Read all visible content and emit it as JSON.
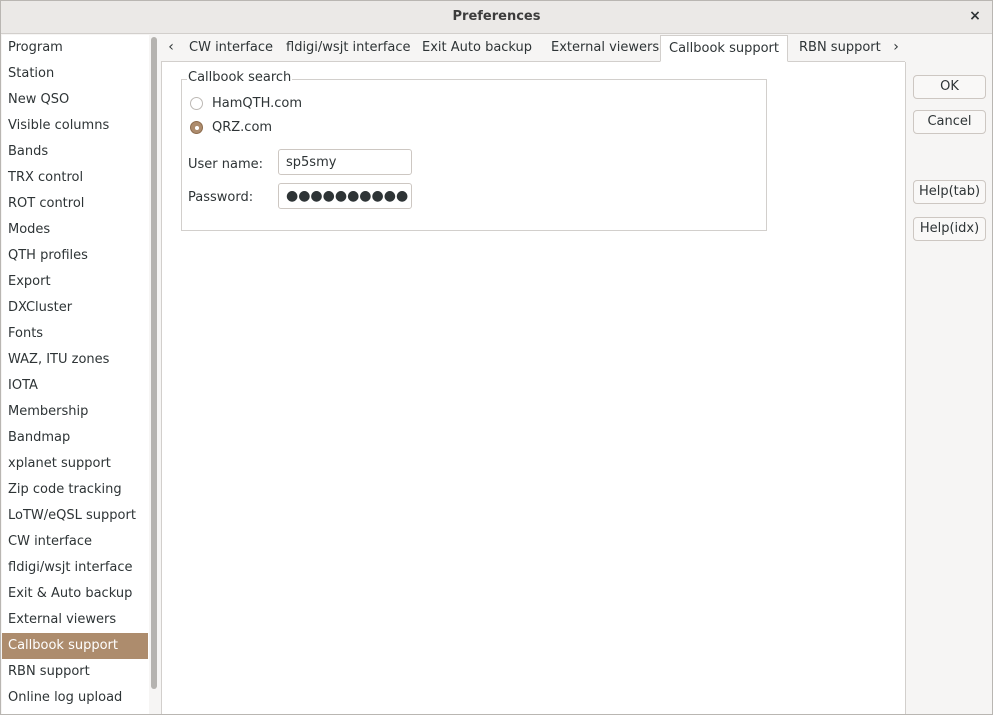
{
  "window": {
    "title": "Preferences",
    "close_glyph": "×"
  },
  "sidebar": {
    "items": [
      "Program",
      "Station",
      "New QSO",
      "Visible columns",
      "Bands",
      "TRX control",
      "ROT control",
      "Modes",
      "QTH profiles",
      "Export",
      "DXCluster",
      "Fonts",
      "WAZ, ITU zones",
      "IOTA",
      "Membership",
      "Bandmap",
      "xplanet support",
      "Zip code tracking",
      "LoTW/eQSL support",
      "CW interface",
      "fldigi/wsjt interface",
      "Exit & Auto backup",
      "External viewers",
      "Callbook support",
      "RBN support",
      "Online log upload"
    ],
    "selected": "Callbook support"
  },
  "tabs": {
    "left_arrow": "‹",
    "right_arrow": "›",
    "items": [
      "CW interface",
      "fldigi/wsjt interface",
      "Exit  Auto backup",
      "External viewers",
      "Callbook support",
      "RBN support"
    ],
    "active": "Callbook support"
  },
  "callbook": {
    "group_title": "Callbook search",
    "options": [
      "HamQTH.com",
      "QRZ.com"
    ],
    "selected_option": "QRZ.com",
    "username_label": "User name:",
    "username_value": "sp5smy",
    "password_label": "Password:",
    "password_mask": "●●●●●●●●●●"
  },
  "buttons": {
    "ok": "OK",
    "cancel": "Cancel",
    "help_tab": "Help(tab)",
    "help_idx": "Help(idx)"
  },
  "colors": {
    "accent": "#ad8c6d",
    "background": "#f6f5f4"
  }
}
